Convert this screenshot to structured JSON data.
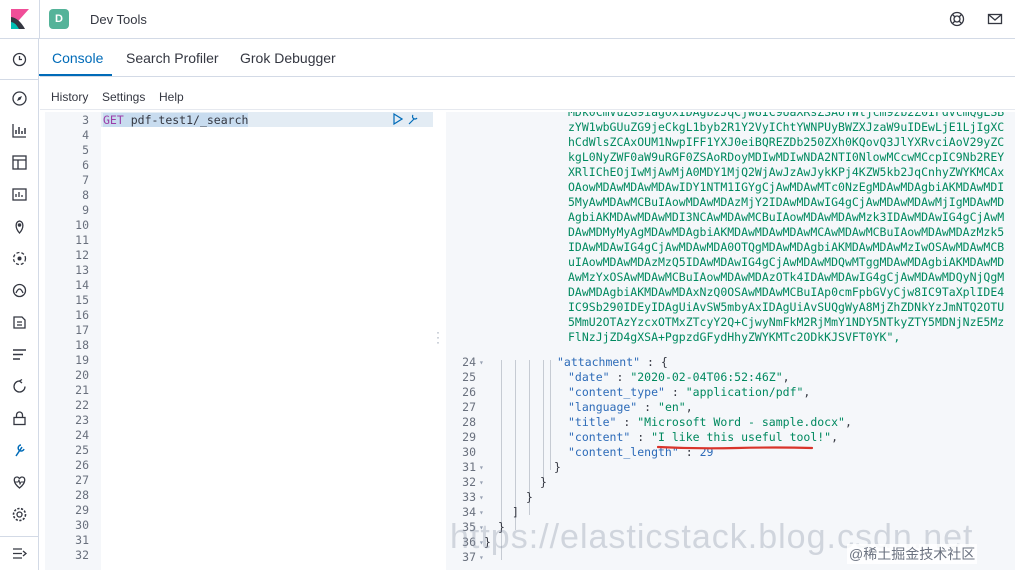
{
  "header": {
    "space_initial": "D",
    "title": "Dev Tools"
  },
  "tabs": [
    {
      "label": "Console"
    },
    {
      "label": "Search Profiler"
    },
    {
      "label": "Grok Debugger"
    }
  ],
  "toolbar": {
    "history": "History",
    "settings": "Settings",
    "help": "Help"
  },
  "editor": {
    "line_numbers": [
      "3",
      "4",
      "5",
      "6",
      "7",
      "8",
      "9",
      "10",
      "11",
      "12",
      "13",
      "14",
      "15",
      "16",
      "17",
      "18",
      "19",
      "20",
      "21",
      "22",
      "23",
      "24",
      "25",
      "26",
      "27",
      "28",
      "29",
      "30",
      "31",
      "32"
    ],
    "request_method": "GET",
    "request_path": "pdf-test1/_search"
  },
  "output": {
    "base64_text": "MDk0CmVuZG9iagoxIDAgb2JqCjw8IC9UaXRsZSAoTWljcm9zb2Z0IFdvcmQgLSBzYW1wbGUuZG9jeCkgL1byb2R1Y2VyIChtYWNPUyBWZXJzaW9uIDEwLjE1LjIgXChCdWlsZCAxOUM1NwpIFF1YXJ0eiBQREZDb250ZXh0KQovQ3JlYXRvciAoV29yZCkgL0NyZWF0aW9uRGF0ZSAoRDoyMDIwMDIwNDA2NTI0NlowMCcwMCcpIC9Nb2REYXRlIChEOjIwMjAwMjA0MDY1MjQ2WjAwJzAwJykKPj4KZW5kb2JqCnhyZWYKMCAxOAowMDAwMDAwMDAwIDY1NTM1IGYgCjAwMDAwMTc0NzEgMDAwMDAgbiAKMDAwMDI5MyAwMDAwMCBuIAowMDAwMDAzMjY2IDAwMDAwIG4gCjAwMDAwMDAwMjIgMDAwMDAgbiAKMDAwMDAwMDI3NCAwMDAwMCBuIAowMDAwMDAwMzk3IDAwMDAwIG4gCjAwMDAwMDMyMyAgMDAwMDAgbiAKMDAwMDAwMDAwMCAwMDAwMCBuIAowMDAwMDAzMzk5IDAwMDAwIG4gCjAwMDAwMDA0OTQgMDAwMDAgbiAKMDAwMDAwMzIwOSAwMDAwMCBuIAowMDAwMDAzMzQ5IDAwMDAwIG4gCjAwMDAwMDQwMTggMDAwMDAgbiAKMDAwMDAwMzYxOSAwMDAwMCBuIAowMDAwMDAzOTk4IDAwMDAwIG4gCjAwMDAwMDQyNjQgMDAwMDAgbiAKMDAwMDAxNzQ0OSAwMDAwMCBuIAp0cmFpbGVyCjw8IC9TaXplIDE4IC9Sb290IDEyIDAgUiAvSW5mbyAxIDAgUiAvSUQgWyA8MjZhZDNkYzJmNTQ2OTU5MmU2OTAzYzcxOTMxZTcyY2Q+CjwyNmFkM2RjMmY1NDY5NTkyZTY5MDNjNzE5MzFlNzJjZD4gXSA+PgpzdGFydHhyZWYKMTc2ODkKJSVFT0YK\",",
    "line_numbers": [
      "24",
      "25",
      "26",
      "27",
      "28",
      "29",
      "30",
      "31",
      "32",
      "33",
      "34",
      "35",
      "36",
      "37"
    ],
    "attachment_key": "\"attachment\"",
    "date_key": "\"date\"",
    "date_value": "\"2020-02-04T06:52:46Z\"",
    "content_type_key": "\"content_type\"",
    "content_type_value": "\"application/pdf\"",
    "language_key": "\"language\"",
    "language_value": "\"en\"",
    "title_key": "\"title\"",
    "title_value": "\"Microsoft Word - sample.docx\"",
    "content_key": "\"content\"",
    "content_value": "\"I like this useful tool!\"",
    "content_length_key": "\"content_length\"",
    "content_length_value": "29"
  },
  "overlays": {
    "watermark": "https://elasticstack.blog.csdn.net",
    "juejin": "@稀土掘金技术社区"
  },
  "colors": {
    "accent": "#006bb8",
    "string": "#00895f",
    "key": "#2d6bb8",
    "annotation": "#d9342b"
  }
}
